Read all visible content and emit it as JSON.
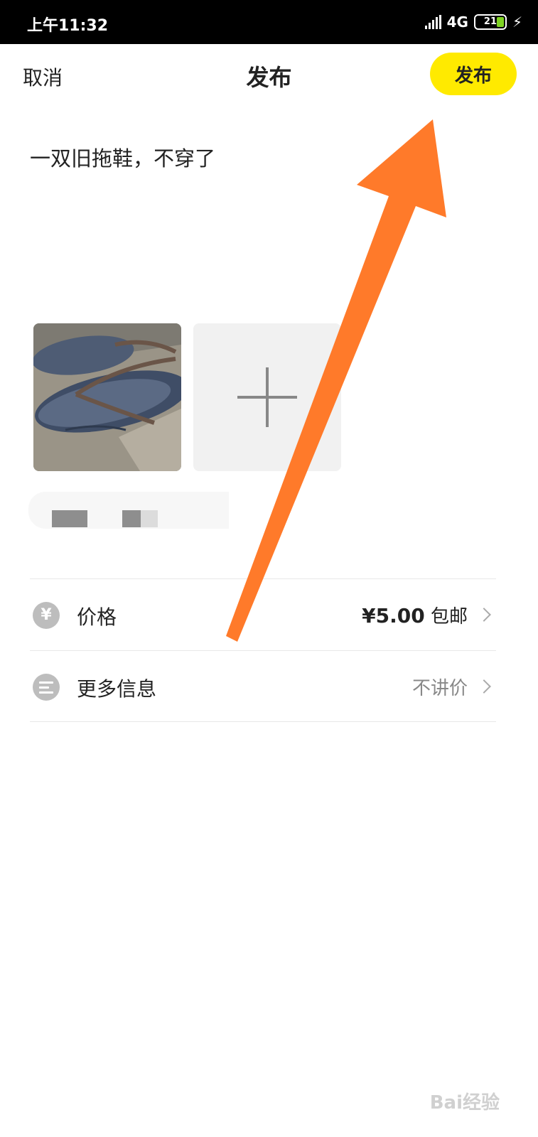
{
  "status_bar": {
    "time": "上午11:32",
    "network": "4G",
    "battery": "21"
  },
  "header": {
    "cancel_label": "取消",
    "title": "发布",
    "publish_label": "发布"
  },
  "description": "一双旧拖鞋，不穿了",
  "price_row": {
    "icon_glyph": "¥",
    "label": "价格",
    "price": "¥5.00",
    "shipping": "包邮"
  },
  "more_row": {
    "label": "更多信息",
    "value": "不讲价"
  },
  "colors": {
    "accent": "#ffea00",
    "arrow": "#ff7a2a"
  },
  "watermark": "Bai经验"
}
